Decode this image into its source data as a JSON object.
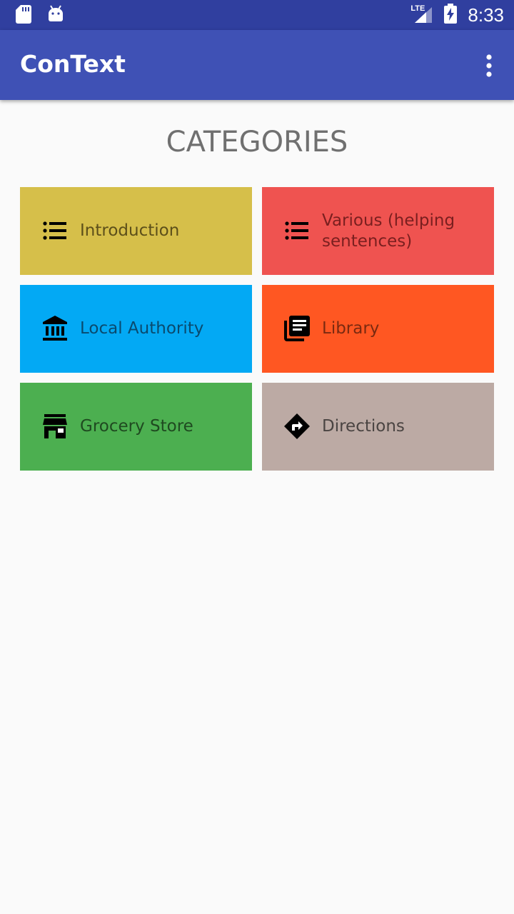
{
  "status_bar": {
    "time": "8:33",
    "network": "LTE",
    "icons": [
      "sd-card-icon",
      "android-icon",
      "lte-signal-icon",
      "battery-charging-icon"
    ]
  },
  "app_bar": {
    "title": "ConText",
    "overflow_icon": "more-vert-icon"
  },
  "page": {
    "title": "CATEGORIES"
  },
  "categories": [
    {
      "label": "Introduction",
      "icon": "list-icon",
      "bg": "#d6bf4a",
      "fg": "#5c4f1a"
    },
    {
      "label": "Various (helping sentences)",
      "icon": "list-icon",
      "bg": "#ef5350",
      "fg": "#7a1f1f"
    },
    {
      "label": "Local Authority",
      "icon": "bank-icon",
      "bg": "#03a9f4",
      "fg": "#0a4a6e"
    },
    {
      "label": "Library",
      "icon": "library-books-icon",
      "bg": "#ff5722",
      "fg": "#7a2a10"
    },
    {
      "label": "Grocery Store",
      "icon": "store-icon",
      "bg": "#4caf50",
      "fg": "#1f4a20"
    },
    {
      "label": "Directions",
      "icon": "directions-icon",
      "bg": "#bcaaa4",
      "fg": "#4a4442"
    }
  ],
  "colors": {
    "status_bar": "#303f9f",
    "app_bar": "#3f51b5",
    "background": "#fafafa"
  }
}
